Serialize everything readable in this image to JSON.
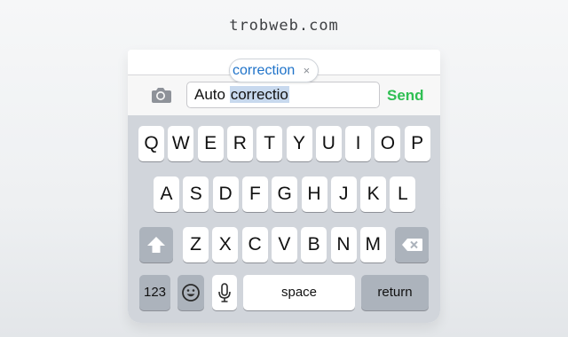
{
  "watermark": "trobweb.com",
  "input_bar": {
    "icon": "camera-icon",
    "text_plain": "Auto ",
    "text_marked": "correctio",
    "send_label": "Send",
    "send_color": "#2fbf53"
  },
  "suggestion": {
    "text": "correction",
    "dismiss": "×"
  },
  "keyboard": {
    "row1": [
      "Q",
      "W",
      "E",
      "R",
      "T",
      "Y",
      "U",
      "I",
      "O",
      "P"
    ],
    "row2": [
      "A",
      "S",
      "D",
      "F",
      "G",
      "H",
      "J",
      "K",
      "L"
    ],
    "row3": [
      "Z",
      "X",
      "C",
      "V",
      "B",
      "N",
      "M"
    ],
    "shift_icon": "shift-arrow-icon",
    "delete_icon": "delete-backspace-icon",
    "numbers_label": "123",
    "emoji_icon": "emoji-smile-icon",
    "mic_icon": "microphone-icon",
    "space_label": "space",
    "return_label": "return"
  }
}
